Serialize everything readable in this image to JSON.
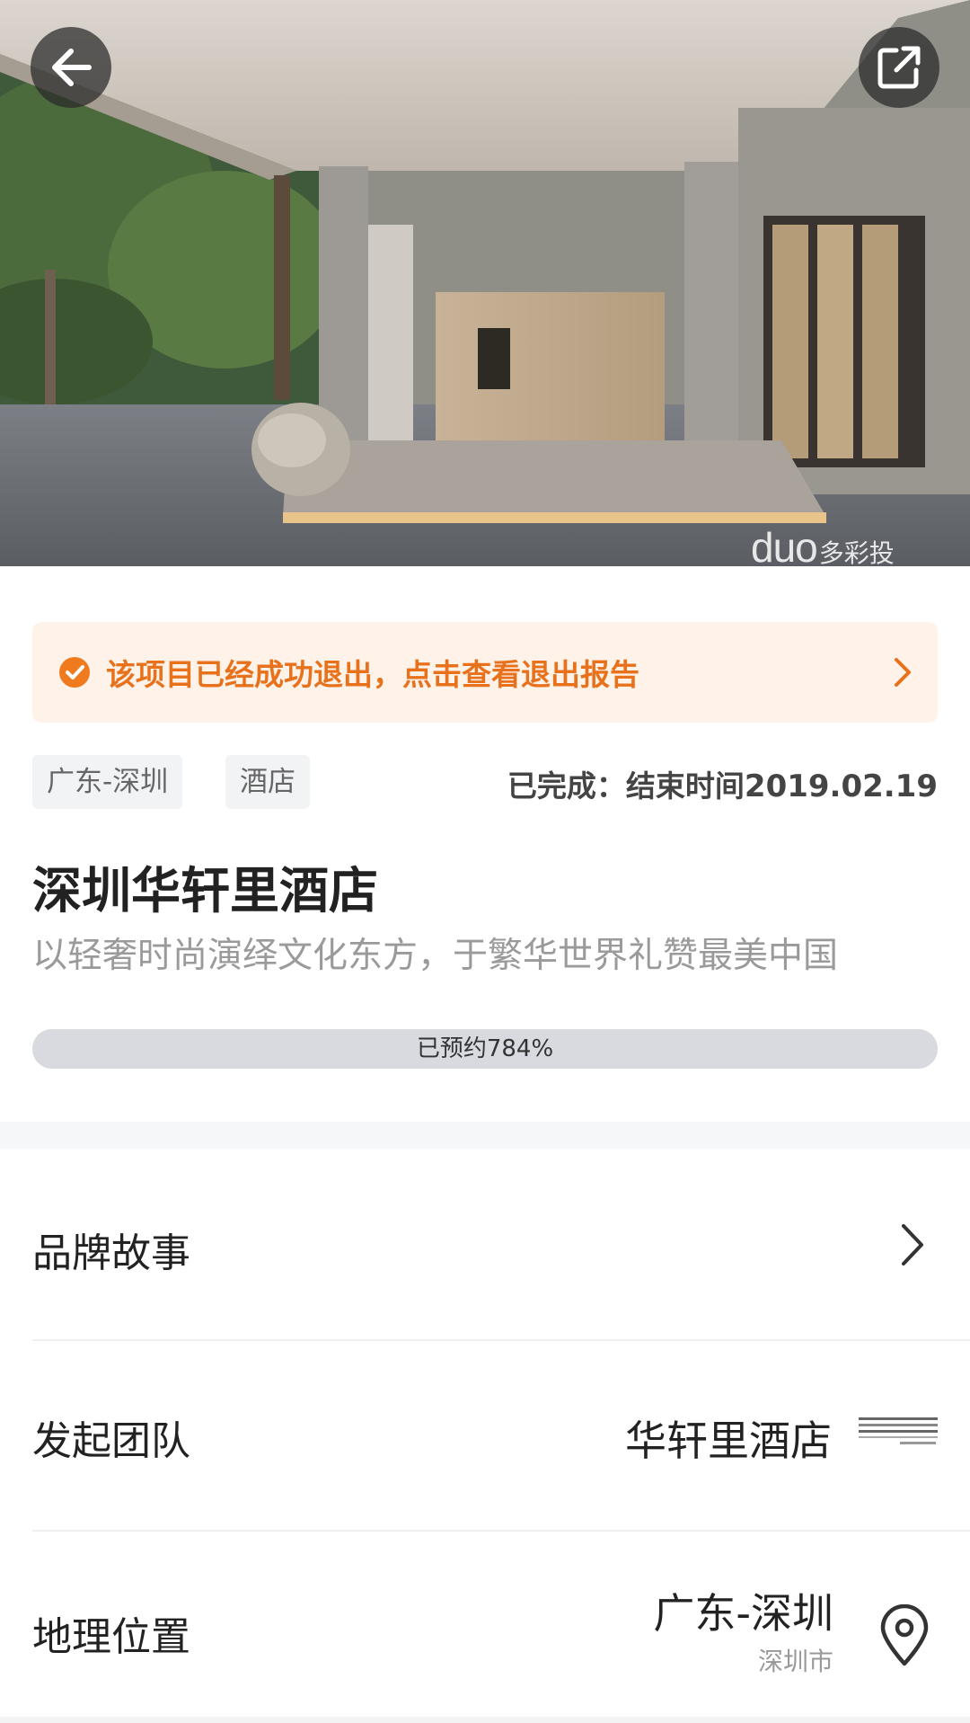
{
  "hero": {
    "image_name": "hotel-entrance-photo",
    "watermark_main": "duo",
    "watermark_cn": "多彩投",
    "back_icon": "arrow-left-icon",
    "share_icon": "external-share-icon"
  },
  "notice": {
    "text": "该项目已经成功退出，点击查看退出报告",
    "icon": "check-circle-icon",
    "accent": "#e8721c",
    "background": "#fff2e9"
  },
  "tags": [
    "广东-深圳",
    "酒店"
  ],
  "status": {
    "prefix": "已完成：结束时间",
    "date": "2019.02.19"
  },
  "project": {
    "title": "深圳华轩里酒店",
    "subtitle": "以轻奢时尚演绎文化东方，于繁华世界礼赞最美中国"
  },
  "progress": {
    "label": "已预约784%",
    "percent": 784
  },
  "rows": {
    "brand_story": {
      "label": "品牌故事"
    },
    "team": {
      "label": "发起团队",
      "value": "华轩里酒店"
    },
    "location": {
      "label": "地理位置",
      "value": "广东-深圳",
      "sub": "深圳市"
    }
  }
}
